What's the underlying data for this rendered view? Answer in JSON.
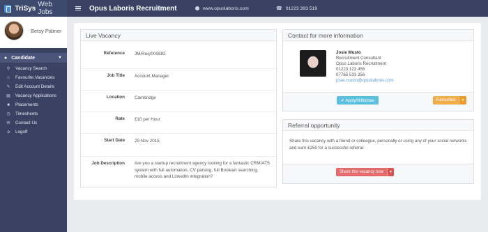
{
  "brand": {
    "name_bold": "TriSys",
    "name_light": "Web Jobs"
  },
  "profile": {
    "name": "Betsy Palmer"
  },
  "nav": {
    "section_label": "Candidate",
    "items": [
      {
        "label": "Vacancy Search",
        "icon": "search-icon"
      },
      {
        "label": "Favourite Vacancies",
        "icon": "star-icon"
      },
      {
        "label": "Edit Account Details",
        "icon": "edit-icon"
      },
      {
        "label": "Vacancy Applications",
        "icon": "document-icon"
      },
      {
        "label": "Placements",
        "icon": "briefcase-icon"
      },
      {
        "label": "Timesheets",
        "icon": "clock-icon"
      },
      {
        "label": "Contact Us",
        "icon": "envelope-icon"
      },
      {
        "label": "Logoff",
        "icon": "logout-icon"
      }
    ]
  },
  "topbar": {
    "title": "Opus Laboris Recruitment",
    "website": "www.opuslaboris.com",
    "phone": "01223 393 519"
  },
  "vacancy": {
    "heading": "Live Vacancy",
    "fields": {
      "reference": {
        "label": "Reference",
        "value": "JM/Req/000882"
      },
      "job_title": {
        "label": "Job Title",
        "value": "Account Manager"
      },
      "location": {
        "label": "Location",
        "value": "Cambridge"
      },
      "rate": {
        "label": "Rate",
        "value": "£10 per Hour"
      },
      "start_date": {
        "label": "Start Date",
        "value": "29 Nov 2015"
      },
      "description": {
        "label": "Job Description",
        "value": "Are you a startup recruitment agency looking for a fantastic CRM/ATS system with full automation, CV parsing, full Boolean searching, mobile access and LinkedIn integration?"
      }
    }
  },
  "contact": {
    "heading": "Contact for more information",
    "name": "Josie Musto",
    "role": "Recruitment Consultant",
    "company": "Opus Laboris Recruitment",
    "phone1": "01223 123 456",
    "phone2": "07765 533 356",
    "email": "josie.musto@opuslaboris.com",
    "apply_label": "✔ Apply/Withdraw",
    "favourites_label": "Favourites"
  },
  "referral": {
    "heading": "Referral opportunity",
    "text": "Share this vacancy with a friend or colleague, personally or using any of your social networks and earn £250 for a successful referral.",
    "share_label": "Share this vacancy now"
  },
  "colors": {
    "sidebar": "#394263",
    "apply": "#5bc0de",
    "favourites": "#f0ad4e",
    "share": "#e26a6a"
  }
}
